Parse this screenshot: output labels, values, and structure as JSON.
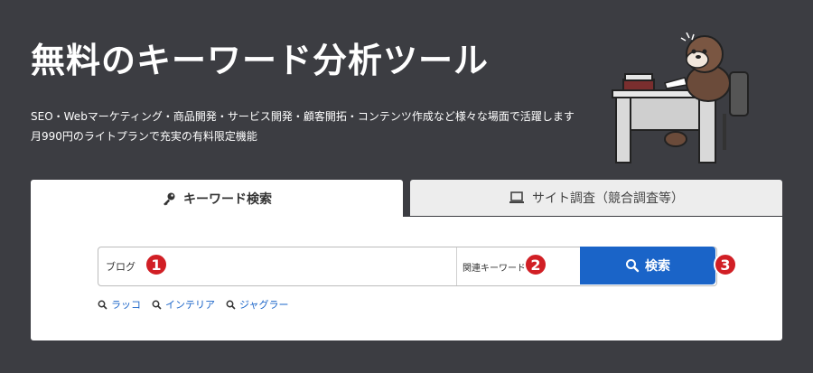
{
  "hero": {
    "title": "無料のキーワード分析ツール",
    "subtitle_line1": "SEO・Webマーケティング・商品開発・サービス開発・顧客開拓・コンテンツ作成など様々な場面で活躍します",
    "subtitle_line2": "月990円のライトプランで充実の有料限定機能"
  },
  "tabs": [
    {
      "label": "キーワード検索",
      "icon": "key-icon",
      "active": true
    },
    {
      "label": "サイト調査（競合調査等）",
      "icon": "laptop-icon",
      "active": false
    }
  ],
  "search": {
    "value": "ブログ",
    "select_value": "関連キーワード",
    "button_label": "検索"
  },
  "badges": [
    "1",
    "2",
    "3"
  ],
  "suggestions": [
    "ラッコ",
    "インテリア",
    "ジャグラー"
  ],
  "colors": {
    "background": "#3c3d42",
    "accent": "#1a64c8",
    "badge": "#d11f25"
  }
}
